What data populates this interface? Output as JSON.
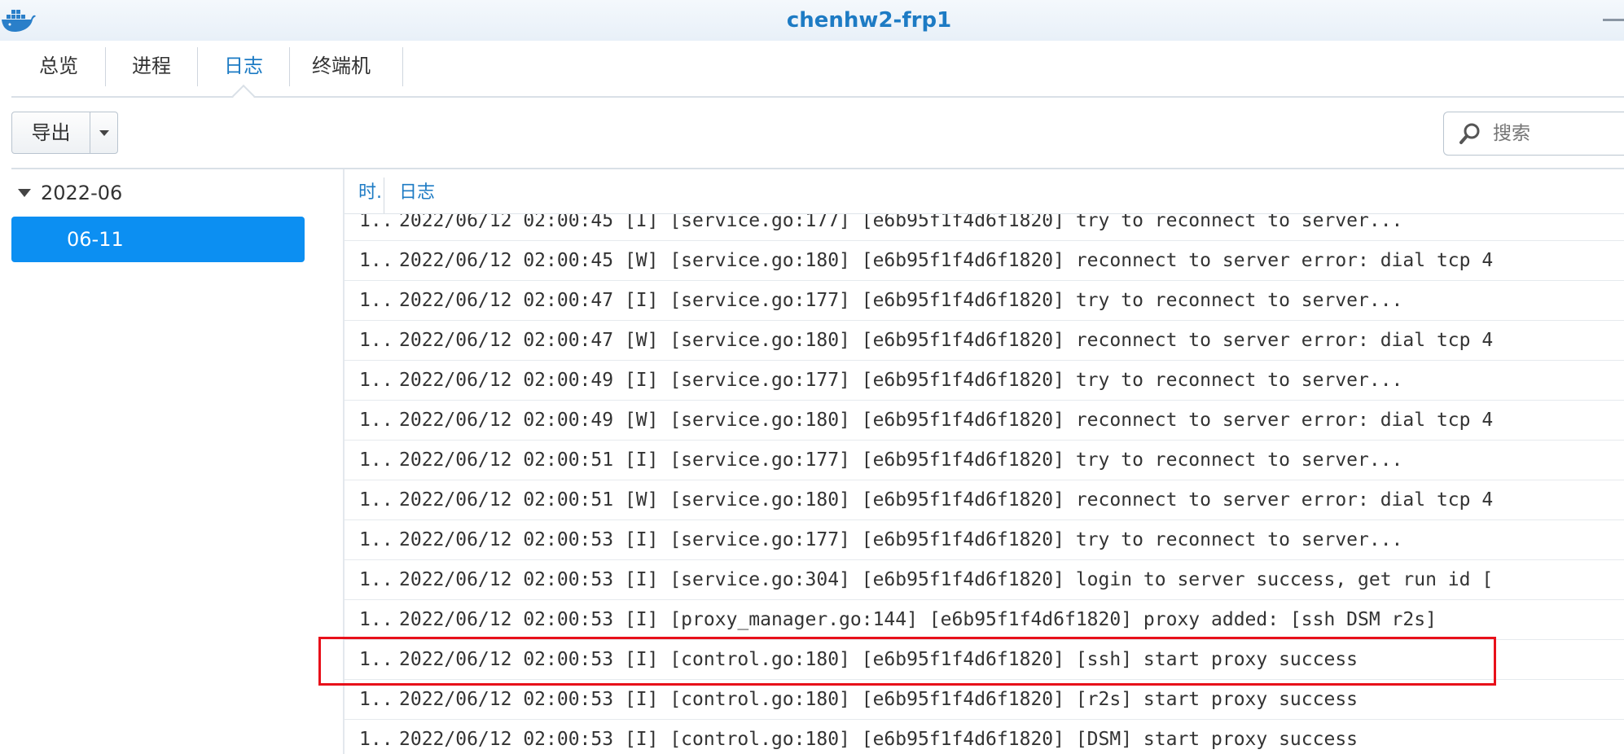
{
  "window": {
    "title": "chenhw2-frp1",
    "app_icon": "docker-whale-icon",
    "minimize_icon": "minimize-icon"
  },
  "tabs": [
    {
      "label": "总览",
      "active": false
    },
    {
      "label": "进程",
      "active": false
    },
    {
      "label": "日志",
      "active": true
    },
    {
      "label": "终端机",
      "active": false
    }
  ],
  "toolbar": {
    "export_label": "导出",
    "search_placeholder": "搜索"
  },
  "tree": {
    "year": "2022-06",
    "day": "06-11"
  },
  "grid": {
    "columns": [
      "时.",
      "日志"
    ],
    "rows": [
      {
        "time": "1..",
        "log": "2022/06/12 02:00:45 [I] [service.go:177] [e6b95f1f4d6f1820] try to reconnect to server..."
      },
      {
        "time": "1..",
        "log": "2022/06/12 02:00:45 [W] [service.go:180] [e6b95f1f4d6f1820] reconnect to server error: dial tcp 4"
      },
      {
        "time": "1..",
        "log": "2022/06/12 02:00:47 [I] [service.go:177] [e6b95f1f4d6f1820] try to reconnect to server..."
      },
      {
        "time": "1..",
        "log": "2022/06/12 02:00:47 [W] [service.go:180] [e6b95f1f4d6f1820] reconnect to server error: dial tcp 4"
      },
      {
        "time": "1..",
        "log": "2022/06/12 02:00:49 [I] [service.go:177] [e6b95f1f4d6f1820] try to reconnect to server..."
      },
      {
        "time": "1..",
        "log": "2022/06/12 02:00:49 [W] [service.go:180] [e6b95f1f4d6f1820] reconnect to server error: dial tcp 4"
      },
      {
        "time": "1..",
        "log": "2022/06/12 02:00:51 [I] [service.go:177] [e6b95f1f4d6f1820] try to reconnect to server..."
      },
      {
        "time": "1..",
        "log": "2022/06/12 02:00:51 [W] [service.go:180] [e6b95f1f4d6f1820] reconnect to server error: dial tcp 4"
      },
      {
        "time": "1..",
        "log": "2022/06/12 02:00:53 [I] [service.go:177] [e6b95f1f4d6f1820] try to reconnect to server..."
      },
      {
        "time": "1..",
        "log": "2022/06/12 02:00:53 [I] [service.go:304] [e6b95f1f4d6f1820] login to server success, get run id ["
      },
      {
        "time": "1..",
        "log": "2022/06/12 02:00:53 [I] [proxy_manager.go:144] [e6b95f1f4d6f1820] proxy added: [ssh DSM r2s]"
      },
      {
        "time": "1..",
        "log": "2022/06/12 02:00:53 [I] [control.go:180] [e6b95f1f4d6f1820] [ssh] start proxy success"
      },
      {
        "time": "1..",
        "log": "2022/06/12 02:00:53 [I] [control.go:180] [e6b95f1f4d6f1820] [r2s] start proxy success"
      },
      {
        "time": "1..",
        "log": "2022/06/12 02:00:53 [I] [control.go:180] [e6b95f1f4d6f1820] [DSM] start proxy success"
      }
    ]
  },
  "colors": {
    "accent": "#1d7bc4",
    "selected": "#0c8ff2",
    "highlight_box": "#e8101a"
  }
}
